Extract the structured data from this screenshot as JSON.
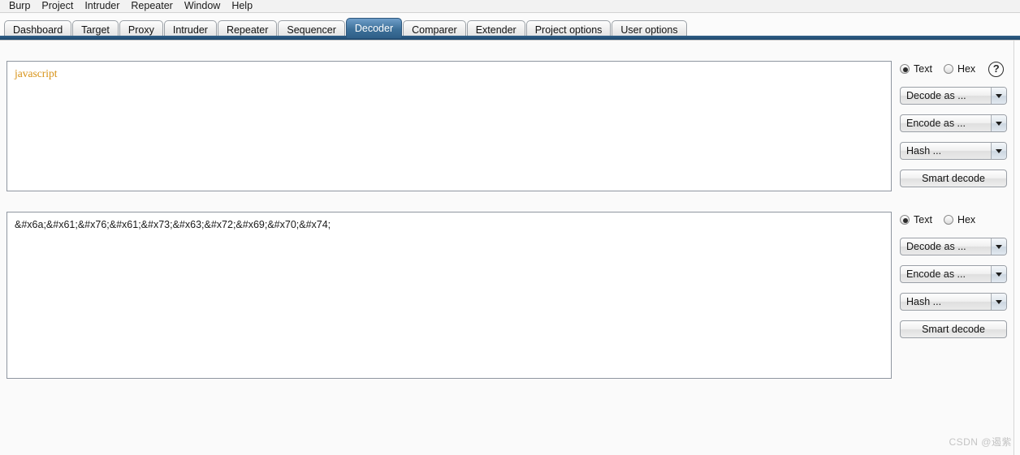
{
  "app": {
    "name": "Burp Suite",
    "watermark": "CSDN @遏紫"
  },
  "menubar": {
    "items": [
      {
        "label": "Burp"
      },
      {
        "label": "Project"
      },
      {
        "label": "Intruder"
      },
      {
        "label": "Repeater"
      },
      {
        "label": "Window"
      },
      {
        "label": "Help"
      }
    ]
  },
  "tabs": {
    "selected": "Decoder",
    "items": [
      {
        "label": "Dashboard"
      },
      {
        "label": "Target"
      },
      {
        "label": "Proxy"
      },
      {
        "label": "Intruder"
      },
      {
        "label": "Repeater"
      },
      {
        "label": "Sequencer"
      },
      {
        "label": "Decoder"
      },
      {
        "label": "Comparer"
      },
      {
        "label": "Extender"
      },
      {
        "label": "Project options"
      },
      {
        "label": "User options"
      }
    ]
  },
  "decoder": {
    "panels": [
      {
        "text_value": "javascript",
        "mode": "Text",
        "radio_text_label": "Text",
        "radio_hex_label": "Hex",
        "help_icon_label": "?",
        "decode_as_label": "Decode as ...",
        "encode_as_label": "Encode as ...",
        "hash_label": "Hash ...",
        "smart_decode_label": "Smart decode"
      },
      {
        "text_value": "&#x6a;&#x61;&#x76;&#x61;&#x73;&#x63;&#x72;&#x69;&#x70;&#x74;",
        "mode": "Text",
        "radio_text_label": "Text",
        "radio_hex_label": "Hex",
        "decode_as_label": "Decode as ...",
        "encode_as_label": "Encode as ...",
        "hash_label": "Hash ...",
        "smart_decode_label": "Smart decode"
      }
    ]
  },
  "colors": {
    "tab_selected": "#3d7099",
    "tab_underline": "#2f5f88",
    "keyword_text": "#d79216",
    "watermark": "#c4c4c4"
  }
}
